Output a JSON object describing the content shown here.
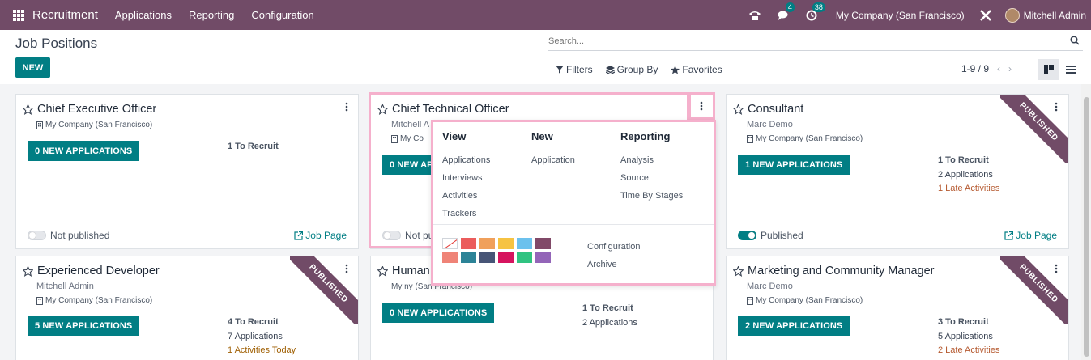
{
  "navbar": {
    "brand": "Recruitment",
    "menus": [
      "Applications",
      "Reporting",
      "Configuration"
    ],
    "messages_count": "4",
    "activities_count": "38",
    "company": "My Company (San Francisco)",
    "user": "Mitchell Admin"
  },
  "control_panel": {
    "title": "Job Positions",
    "new_button": "NEW",
    "search_placeholder": "Search...",
    "filters": "Filters",
    "group_by": "Group By",
    "favorites": "Favorites",
    "pager": "1-9 / 9"
  },
  "cards": [
    {
      "name": "Chief Executive Officer",
      "responsible": "",
      "company": "My Company (San Francisco)",
      "button": "0 NEW APPLICATIONS",
      "recruit": "1 To Recruit",
      "applications": "",
      "activities": "",
      "status": "Not published",
      "job_page": "Job Page",
      "ribbon": ""
    },
    {
      "name": "Chief Technical Officer",
      "responsible": "Mitchell A",
      "company": "My Co",
      "button": "0 NEW AP",
      "status": "Not pu"
    },
    {
      "name": "Consultant",
      "responsible": "Marc Demo",
      "company": "My Company (San Francisco)",
      "button": "1 NEW APPLICATIONS",
      "recruit": "1 To Recruit",
      "applications": "2 Applications",
      "activities": "1 Late Activities",
      "status": "Published",
      "job_page": "Job Page",
      "ribbon": "PUBLISHED"
    },
    {
      "name": "Experienced Developer",
      "responsible": "Mitchell Admin",
      "company": "My Company (San Francisco)",
      "button": "5 NEW APPLICATIONS",
      "recruit": "4 To Recruit",
      "applications": "7 Applications",
      "activities": "1 Activities Today",
      "ribbon": "PUBLISHED"
    },
    {
      "name": "Human",
      "responsible": "",
      "company": "My    ny (San Francisco)",
      "button": "0 NEW APPLICATIONS",
      "recruit": "1 To Recruit",
      "applications": "2 Applications"
    },
    {
      "name": "Marketing and Community Manager",
      "responsible": "Marc Demo",
      "company": "My Company (San Francisco)",
      "button": "2 NEW APPLICATIONS",
      "recruit": "3 To Recruit",
      "applications": "5 Applications",
      "activities": "2 Late Activities",
      "ribbon": "PUBLISHED"
    }
  ],
  "dropdown": {
    "view": {
      "title": "View",
      "items": [
        "Applications",
        "Interviews",
        "Activities",
        "Trackers"
      ]
    },
    "new": {
      "title": "New",
      "items": [
        "Application"
      ]
    },
    "reporting": {
      "title": "Reporting",
      "items": [
        "Analysis",
        "Source",
        "Time By Stages"
      ]
    },
    "colors": [
      "none",
      "#EB5C5C",
      "#F0A05B",
      "#F6C342",
      "#6CC1ED",
      "#814968",
      "#EF8377",
      "#2C8397",
      "#475577",
      "#D6145F",
      "#30C381",
      "#9365B8"
    ],
    "configuration": "Configuration",
    "archive": "Archive"
  }
}
